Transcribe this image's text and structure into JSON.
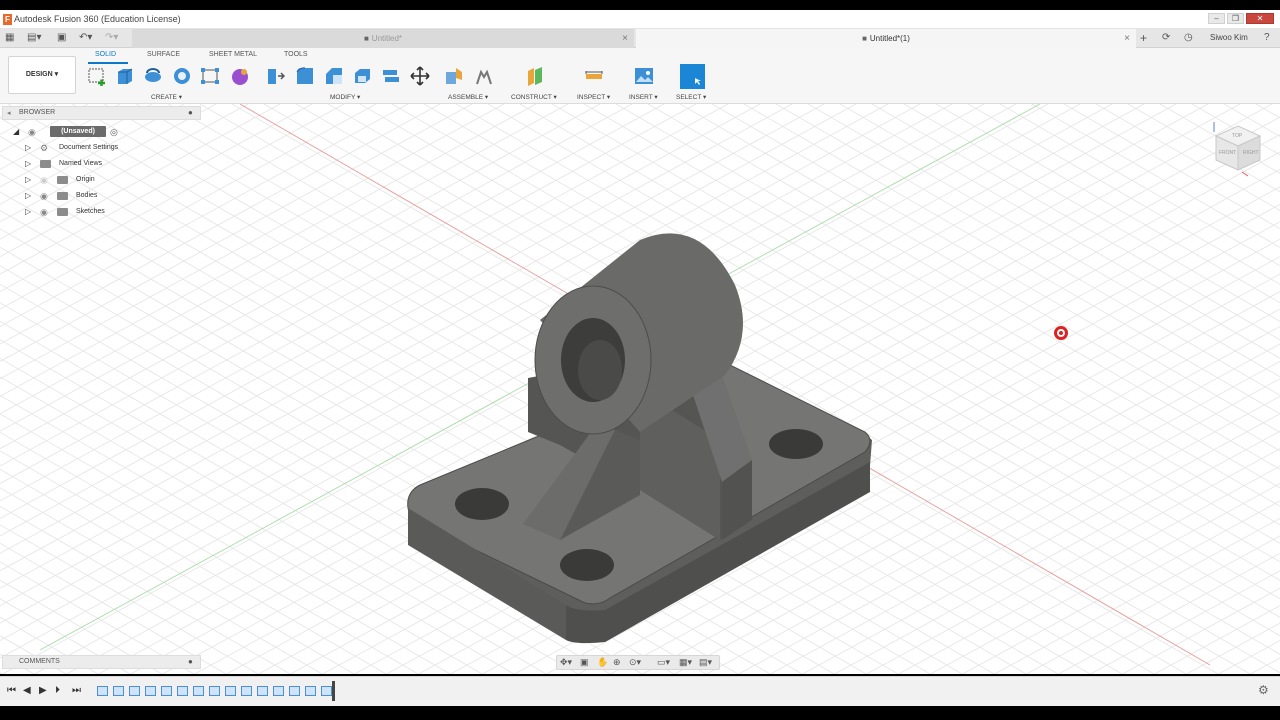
{
  "window": {
    "title": "Autodesk Fusion 360 (Education License)",
    "icon_letter": "F"
  },
  "tabs": [
    {
      "label": "Untitled*",
      "active": false
    },
    {
      "label": "Untitled*(1)",
      "active": true
    }
  ],
  "user": {
    "name": "Siwoo Kim"
  },
  "toolbar": {
    "workspace": "DESIGN",
    "workspace_tabs": [
      "SOLID",
      "SURFACE",
      "SHEET METAL",
      "TOOLS"
    ],
    "groups": [
      "CREATE",
      "MODIFY",
      "ASSEMBLE",
      "CONSTRUCT",
      "INSPECT",
      "INSERT",
      "SELECT"
    ]
  },
  "browser": {
    "title": "BROWSER",
    "root_label": "(Unsaved)",
    "items": [
      "Document Settings",
      "Named Views",
      "Origin",
      "Bodies",
      "Sketches"
    ]
  },
  "comments": {
    "title": "COMMENTS"
  },
  "viewcube": {
    "top": "TOP",
    "front": "FRONT",
    "right": "RIGHT"
  },
  "colors": {
    "accent": "#0a78c8",
    "model": "#6a6a68",
    "grid": "#e3e3e3",
    "x_axis": "#e07070",
    "y_axis": "#7fd07f"
  },
  "icons": [
    "grid-menu-icon",
    "file-icon",
    "save-icon",
    "undo-icon",
    "redo-icon",
    "add-tab-icon",
    "job-status-icon",
    "clock-icon",
    "help-icon",
    "gear-icon"
  ]
}
